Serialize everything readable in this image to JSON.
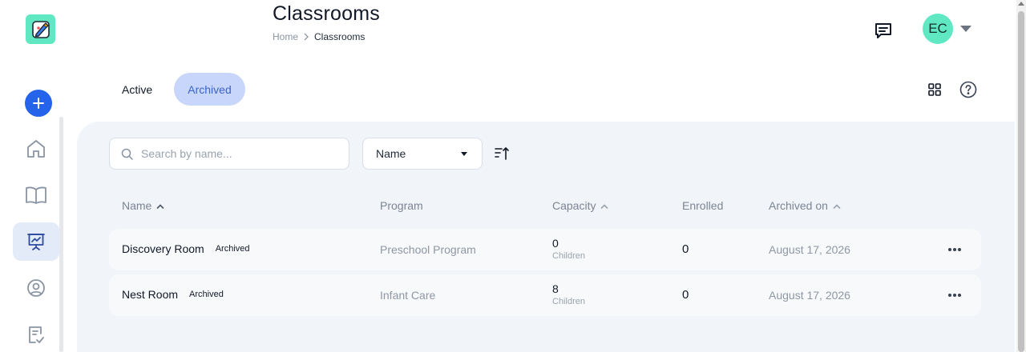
{
  "header": {
    "title": "Classrooms",
    "breadcrumb": [
      "Home",
      "Classrooms"
    ],
    "user_initials": "EC"
  },
  "sidebar": {
    "items": [
      {
        "icon": "home-icon"
      },
      {
        "icon": "book-icon"
      },
      {
        "icon": "presentation-icon",
        "active": true
      },
      {
        "icon": "user-circle-icon"
      },
      {
        "icon": "clipboard-check-icon"
      }
    ]
  },
  "tabs": [
    {
      "label": "Active",
      "selected": false
    },
    {
      "label": "Archived",
      "selected": true
    }
  ],
  "filters": {
    "search_placeholder": "Search by name...",
    "sort_value": "Name"
  },
  "table": {
    "columns": [
      {
        "label": "Name",
        "sortable": true
      },
      {
        "label": "Program"
      },
      {
        "label": "Capacity",
        "sortable": true
      },
      {
        "label": "Enrolled"
      },
      {
        "label": "Archived on",
        "sortable": true
      }
    ],
    "rows": [
      {
        "name": "Discovery Room",
        "badge": "Archived",
        "program": "Preschool Program",
        "capacity": "0",
        "capacity_unit": "Children",
        "enrolled": "0",
        "archived_on": "August 17, 2026"
      },
      {
        "name": "Nest Room",
        "badge": "Archived",
        "program": "Infant Care",
        "capacity": "8",
        "capacity_unit": "Children",
        "enrolled": "0",
        "archived_on": "August 17, 2026"
      }
    ]
  },
  "colors": {
    "accent": "#2563eb",
    "brand": "#5fe8c2",
    "selected_tab_bg": "#c8d6fb",
    "panel_bg": "#f1f4f9"
  }
}
